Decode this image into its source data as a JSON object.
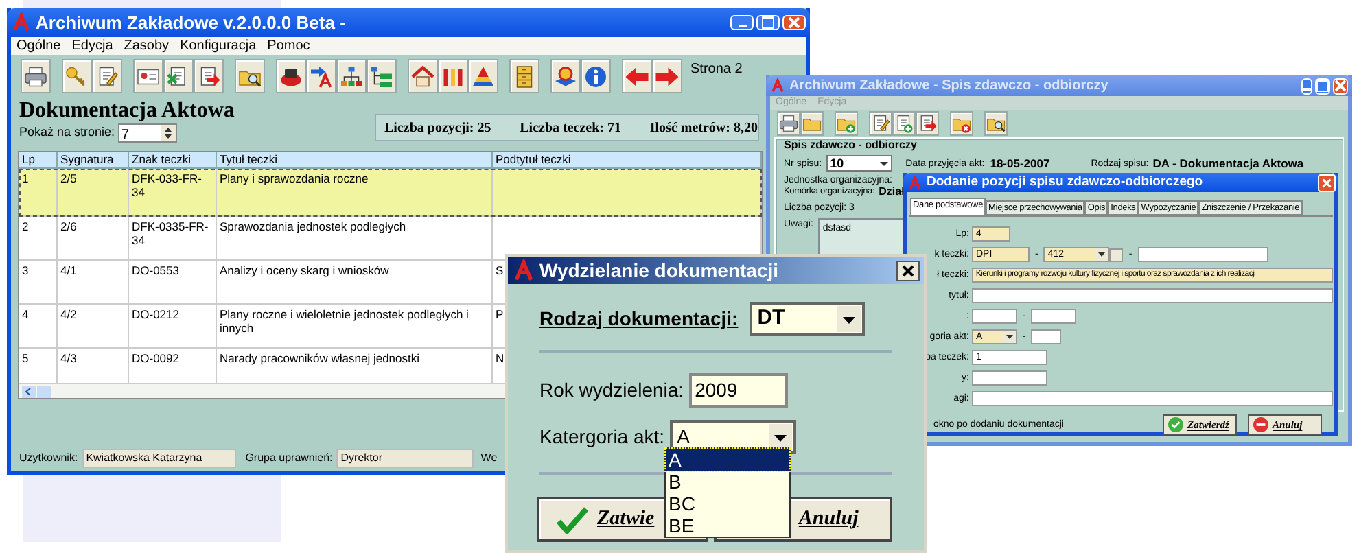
{
  "main_window": {
    "title": "Archiwum Zakładowe v.2.0.0.0 Beta -",
    "menu": [
      "Ogólne",
      "Edycja",
      "Zasoby",
      "Konfiguracja",
      "Pomoc"
    ],
    "page_indicator": "Strona 2",
    "heading": "Dokumentacja Aktowa",
    "page_size": {
      "label": "Pokaż na stronie:",
      "value": "7"
    },
    "stats": [
      "Liczba pozycji: 25",
      "Liczba teczek: 71",
      "Ilość metrów: 8,20"
    ],
    "table": {
      "columns": [
        "Lp",
        "Sygnatura",
        "Znak teczki",
        "Tytuł teczki",
        "Podtytuł teczki"
      ],
      "rows": [
        {
          "cells": [
            "1",
            "2/5",
            "DFK-033-FR-34",
            "Plany i sprawozdania roczne",
            ""
          ],
          "selected": true
        },
        {
          "cells": [
            "2",
            "2/6",
            "DFK-0335-FR-34",
            "Sprawozdania jednostek podległych",
            ""
          ],
          "selected": false
        },
        {
          "cells": [
            "3",
            "4/1",
            "DO-0553",
            "Analizy i oceny skarg i wniosków",
            "S"
          ],
          "selected": false
        },
        {
          "cells": [
            "4",
            "4/2",
            "DO-0212",
            "Plany roczne i wieloletnie jednostek podległych i innych",
            "P"
          ],
          "selected": false
        },
        {
          "cells": [
            "5",
            "4/3",
            "DO-0092",
            "Narady pracowników własnej jednostki",
            "N"
          ],
          "selected": false
        }
      ]
    },
    "status_bar": [
      {
        "label": "Użytkownik:",
        "value": "Kwiatkowska Katarzyna"
      },
      {
        "label": "Grupa uprawnień:",
        "value": "Dyrektor"
      },
      {
        "label": "We"
      }
    ]
  },
  "spis_window": {
    "title": "Archiwum Zakładowe - Spis zdawczo - odbiorczy",
    "menu": [
      "Ogólne",
      "Edycja"
    ],
    "group_title": "Spis zdawczo - odbiorczy",
    "nr_spisu": {
      "label": "Nr spisu:",
      "value": "10"
    },
    "data_przyjecia": {
      "label": "Data przyjęcia akt:",
      "value": "18-05-2007"
    },
    "rodzaj_spisu": {
      "label": "Rodzaj spisu:",
      "value": "DA - Dokumentacja Aktowa"
    },
    "jednostka_label": "Jednostka organizacyjna:",
    "komorka": {
      "label": "Komórka organizacyjna:",
      "value": "Dział"
    },
    "liczba_pozycji": "Liczba pozycji: 3",
    "uwagi": {
      "label": "Uwagi:",
      "value": "dsfasd"
    }
  },
  "add_dialog": {
    "title": "Dodanie pozycji spisu zdawczo-odbiorczego",
    "tabs": [
      {
        "label": "Dane podstawowe",
        "selected": true
      },
      {
        "label": "Miejsce przechowywania",
        "selected": false
      },
      {
        "label": "Opis",
        "selected": false
      },
      {
        "label": "Indeks",
        "selected": false
      },
      {
        "label": "Wypożyczanie",
        "selected": false
      },
      {
        "label": "Zniszczenie / Przekazanie",
        "selected": false
      }
    ],
    "fields": [
      {
        "kind": "single",
        "label": "Lp:",
        "value": "4"
      },
      {
        "kind": "znak",
        "label": "k teczki:",
        "value": "DPI",
        "value_2": "412",
        "separators": [
          "-",
          "-"
        ]
      },
      {
        "kind": "wide",
        "label": "ł teczki:",
        "value": "Kierunki i programy rozwoju kultury fizycznej i sportu oraz sprawozdania z ich realizacji"
      },
      {
        "kind": "wide",
        "label": "tytuł:"
      },
      {
        "kind": "pair",
        "label": ":",
        "separators": [
          "-"
        ]
      },
      {
        "kind": "combo_pair",
        "label": "goria akt:",
        "value": "A",
        "separators": [
          "-"
        ]
      },
      {
        "kind": "medium",
        "label": "ba teczek:",
        "value": "1"
      },
      {
        "kind": "medium",
        "label": "y:"
      },
      {
        "kind": "wide",
        "label": "agi:"
      }
    ],
    "option_text": "okno po dodaniu dokumentacji",
    "buttons": [
      "Zatwierdź",
      "Anuluj"
    ]
  },
  "split_dialog": {
    "title": "Wydzielanie dokumentacji",
    "rodzaj": {
      "label": "Rodzaj dokumentacji:",
      "value": "DT"
    },
    "rok": {
      "label": "Rok wydzielenia:",
      "value": "2009"
    },
    "kategoria": {
      "label": "Katergoria akt:",
      "value": "A",
      "options": [
        {
          "label": "A",
          "selected": true
        },
        {
          "label": "B",
          "selected": false
        },
        {
          "label": "BC",
          "selected": false
        },
        {
          "label": "BE",
          "selected": false
        }
      ]
    },
    "buttons": [
      "Zatwie",
      "Anuluj"
    ]
  }
}
